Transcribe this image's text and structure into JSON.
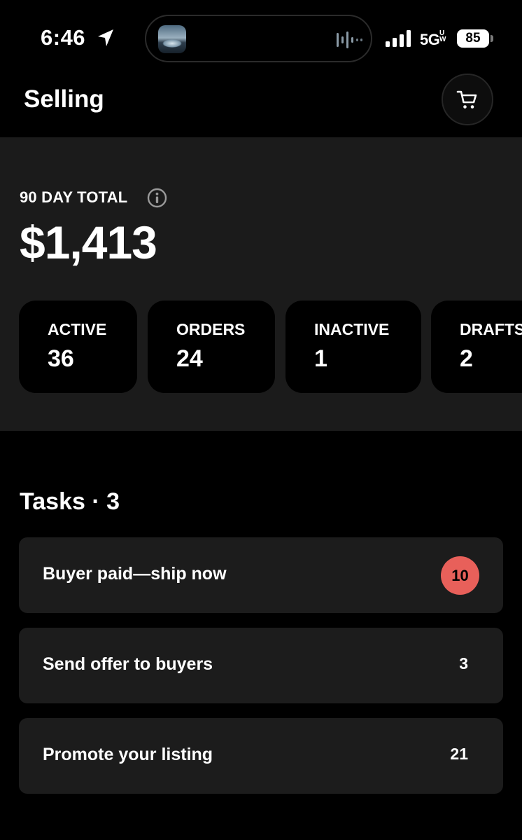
{
  "status_bar": {
    "time": "6:46",
    "network": "5G",
    "network_sup_top": "U",
    "network_sup_bottom": "W",
    "battery": "85"
  },
  "header": {
    "title": "Selling"
  },
  "summary": {
    "total_label": "90 DAY TOTAL",
    "total_value": "$1,413",
    "stats": [
      {
        "label": "ACTIVE",
        "value": "36"
      },
      {
        "label": "ORDERS",
        "value": "24"
      },
      {
        "label": "INACTIVE",
        "value": "1"
      },
      {
        "label": "DRAFTS",
        "value": "2"
      }
    ]
  },
  "tasks": {
    "title": "Tasks · 3",
    "items": [
      {
        "label": "Buyer paid—ship now",
        "count": "10"
      },
      {
        "label": "Send offer to buyers",
        "count": "3"
      },
      {
        "label": "Promote your listing",
        "count": "21"
      }
    ]
  },
  "colors": {
    "background": "#000000",
    "panel": "#1b1b1b",
    "badge": "#e8605a"
  }
}
